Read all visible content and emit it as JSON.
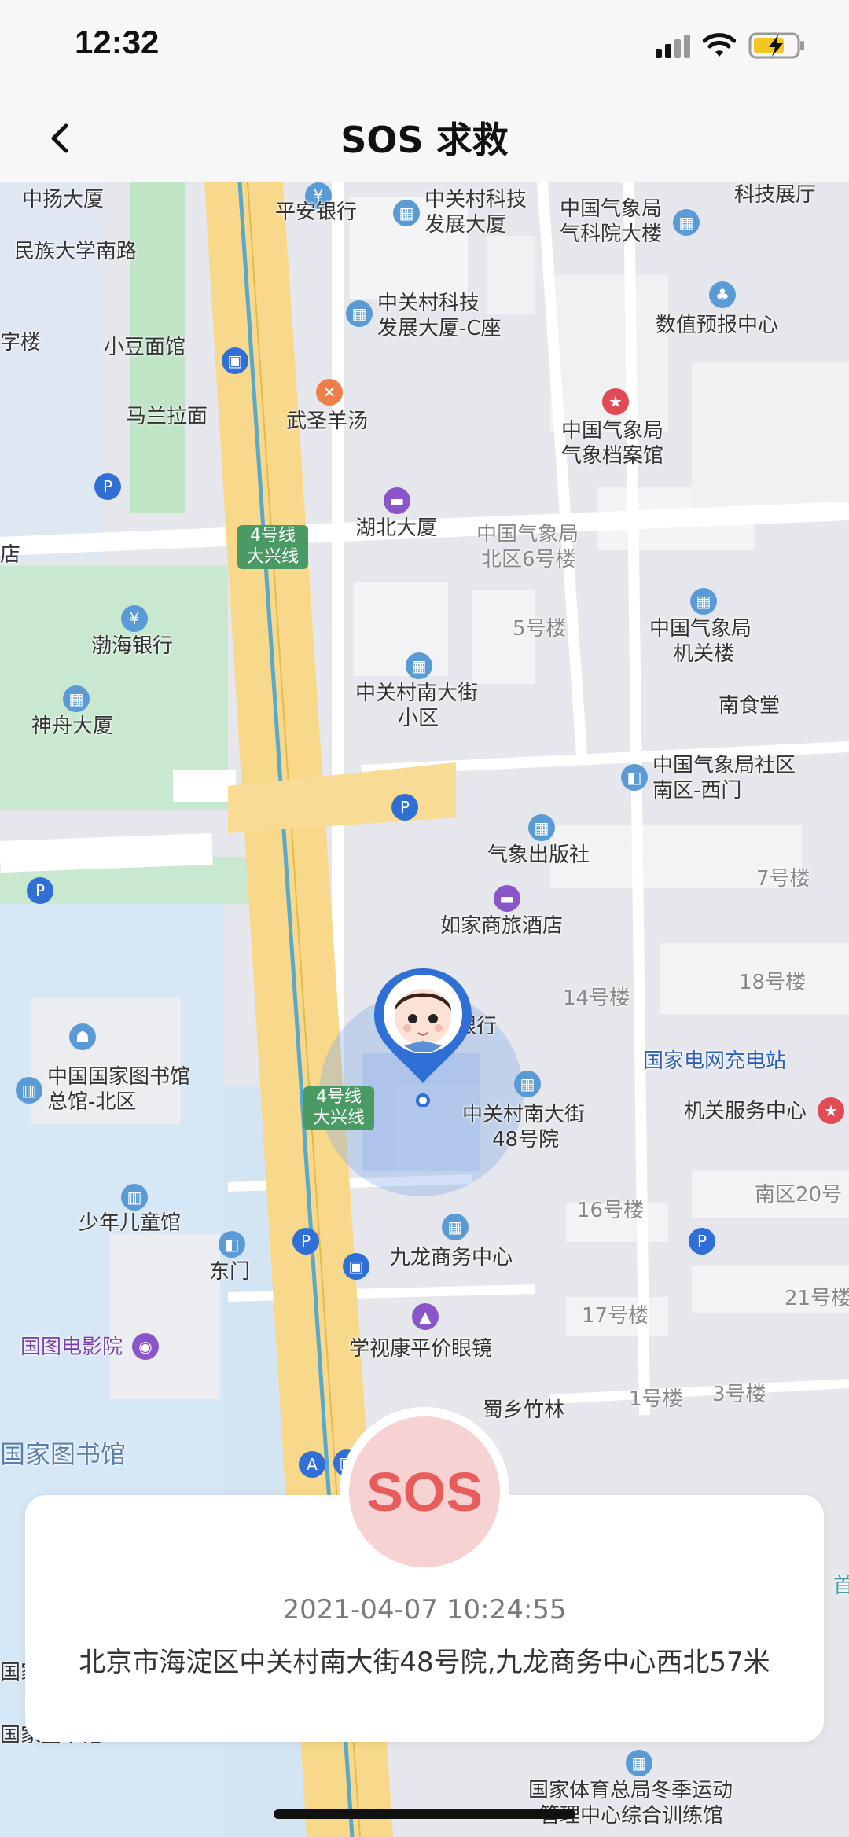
{
  "status_bar": {
    "time": "12:32"
  },
  "header": {
    "title": "SOS 求救"
  },
  "map": {
    "labels": [
      {
        "t": "中扬大厦"
      },
      {
        "t": "平安银行"
      },
      {
        "t": "中关村科技"
      },
      {
        "t": "发展大厦"
      },
      {
        "t": "中国气象局"
      },
      {
        "t": "气科院大楼"
      },
      {
        "t": "科技展厅"
      },
      {
        "t": "民族大学南路"
      },
      {
        "t": "中关村科技"
      },
      {
        "t": "发展大厦-C座"
      },
      {
        "t": "数值预报中心"
      },
      {
        "t": "字楼"
      },
      {
        "t": "小豆面馆"
      },
      {
        "t": "马兰拉面"
      },
      {
        "t": "武圣羊汤"
      },
      {
        "t": "中国气象局"
      },
      {
        "t": "气象档案馆"
      },
      {
        "t": "湖北大厦"
      },
      {
        "t": "中国气象局"
      },
      {
        "t": "北区6号楼"
      },
      {
        "t": "店"
      },
      {
        "t": "渤海银行"
      },
      {
        "t": "5号楼"
      },
      {
        "t": "中国气象局"
      },
      {
        "t": "机关楼"
      },
      {
        "t": "中关村南大街"
      },
      {
        "t": "小区"
      },
      {
        "t": "神舟大厦"
      },
      {
        "t": "南食堂"
      },
      {
        "t": "中国气象局社区"
      },
      {
        "t": "南区-西门"
      },
      {
        "t": "气象出版社"
      },
      {
        "t": "7号楼"
      },
      {
        "t": "如家商旅酒店"
      },
      {
        "t": "18号楼"
      },
      {
        "t": "14号楼"
      },
      {
        "t": "银行"
      },
      {
        "t": "中国国家图书馆"
      },
      {
        "t": "总馆-北区"
      },
      {
        "t": "国家电网充电站"
      },
      {
        "t": "中关村南大街"
      },
      {
        "t": "48号院"
      },
      {
        "t": "机关服务中心"
      },
      {
        "t": "南区20号"
      },
      {
        "t": "少年儿童馆"
      },
      {
        "t": "16号楼"
      },
      {
        "t": "东门"
      },
      {
        "t": "九龙商务中心"
      },
      {
        "t": "21号楼"
      },
      {
        "t": "国图电影院"
      },
      {
        "t": "17号楼"
      },
      {
        "t": "学视康平价眼镜"
      },
      {
        "t": "蜀乡竹林"
      },
      {
        "t": "1号楼"
      },
      {
        "t": "3号楼"
      },
      {
        "t": "国家图书馆"
      },
      {
        "t": "国家体育总局冬季运动"
      },
      {
        "t": "管理中心综合训练馆"
      },
      {
        "t": "首"
      },
      {
        "t": "国家"
      },
      {
        "t": "国家图书馆"
      }
    ],
    "line_badges": [
      {
        "line": "4号线",
        "sub": "大兴线"
      },
      {
        "line": "4号线",
        "sub": "大兴线"
      }
    ]
  },
  "sos": {
    "label": "SOS"
  },
  "alert_card": {
    "timestamp": "2021-04-07 10:24:55",
    "address": "北京市海淀区中关村南大街48号院,九龙商务中心西北57米"
  },
  "colors": {
    "sos_red": "#e85c5c",
    "sos_bg": "#f6d2d2",
    "map_road": "#f8d98b",
    "accent_blue": "#2f6fd6"
  }
}
